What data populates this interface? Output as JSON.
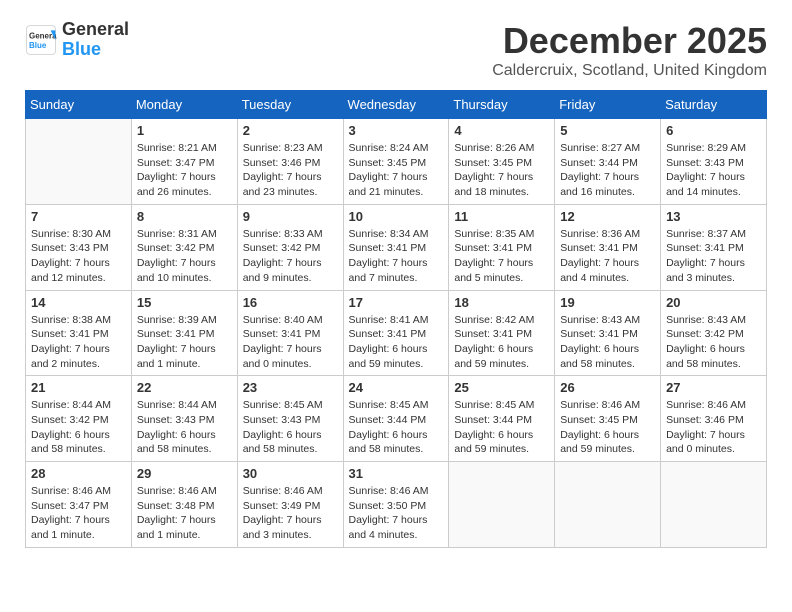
{
  "logo": {
    "general": "General",
    "blue": "Blue"
  },
  "title": "December 2025",
  "location": "Caldercruix, Scotland, United Kingdom",
  "weekdays": [
    "Sunday",
    "Monday",
    "Tuesday",
    "Wednesday",
    "Thursday",
    "Friday",
    "Saturday"
  ],
  "weeks": [
    [
      {
        "day": "",
        "info": ""
      },
      {
        "day": "1",
        "info": "Sunrise: 8:21 AM\nSunset: 3:47 PM\nDaylight: 7 hours\nand 26 minutes."
      },
      {
        "day": "2",
        "info": "Sunrise: 8:23 AM\nSunset: 3:46 PM\nDaylight: 7 hours\nand 23 minutes."
      },
      {
        "day": "3",
        "info": "Sunrise: 8:24 AM\nSunset: 3:45 PM\nDaylight: 7 hours\nand 21 minutes."
      },
      {
        "day": "4",
        "info": "Sunrise: 8:26 AM\nSunset: 3:45 PM\nDaylight: 7 hours\nand 18 minutes."
      },
      {
        "day": "5",
        "info": "Sunrise: 8:27 AM\nSunset: 3:44 PM\nDaylight: 7 hours\nand 16 minutes."
      },
      {
        "day": "6",
        "info": "Sunrise: 8:29 AM\nSunset: 3:43 PM\nDaylight: 7 hours\nand 14 minutes."
      }
    ],
    [
      {
        "day": "7",
        "info": "Sunrise: 8:30 AM\nSunset: 3:43 PM\nDaylight: 7 hours\nand 12 minutes."
      },
      {
        "day": "8",
        "info": "Sunrise: 8:31 AM\nSunset: 3:42 PM\nDaylight: 7 hours\nand 10 minutes."
      },
      {
        "day": "9",
        "info": "Sunrise: 8:33 AM\nSunset: 3:42 PM\nDaylight: 7 hours\nand 9 minutes."
      },
      {
        "day": "10",
        "info": "Sunrise: 8:34 AM\nSunset: 3:41 PM\nDaylight: 7 hours\nand 7 minutes."
      },
      {
        "day": "11",
        "info": "Sunrise: 8:35 AM\nSunset: 3:41 PM\nDaylight: 7 hours\nand 5 minutes."
      },
      {
        "day": "12",
        "info": "Sunrise: 8:36 AM\nSunset: 3:41 PM\nDaylight: 7 hours\nand 4 minutes."
      },
      {
        "day": "13",
        "info": "Sunrise: 8:37 AM\nSunset: 3:41 PM\nDaylight: 7 hours\nand 3 minutes."
      }
    ],
    [
      {
        "day": "14",
        "info": "Sunrise: 8:38 AM\nSunset: 3:41 PM\nDaylight: 7 hours\nand 2 minutes."
      },
      {
        "day": "15",
        "info": "Sunrise: 8:39 AM\nSunset: 3:41 PM\nDaylight: 7 hours\nand 1 minute."
      },
      {
        "day": "16",
        "info": "Sunrise: 8:40 AM\nSunset: 3:41 PM\nDaylight: 7 hours\nand 0 minutes."
      },
      {
        "day": "17",
        "info": "Sunrise: 8:41 AM\nSunset: 3:41 PM\nDaylight: 6 hours\nand 59 minutes."
      },
      {
        "day": "18",
        "info": "Sunrise: 8:42 AM\nSunset: 3:41 PM\nDaylight: 6 hours\nand 59 minutes."
      },
      {
        "day": "19",
        "info": "Sunrise: 8:43 AM\nSunset: 3:41 PM\nDaylight: 6 hours\nand 58 minutes."
      },
      {
        "day": "20",
        "info": "Sunrise: 8:43 AM\nSunset: 3:42 PM\nDaylight: 6 hours\nand 58 minutes."
      }
    ],
    [
      {
        "day": "21",
        "info": "Sunrise: 8:44 AM\nSunset: 3:42 PM\nDaylight: 6 hours\nand 58 minutes."
      },
      {
        "day": "22",
        "info": "Sunrise: 8:44 AM\nSunset: 3:43 PM\nDaylight: 6 hours\nand 58 minutes."
      },
      {
        "day": "23",
        "info": "Sunrise: 8:45 AM\nSunset: 3:43 PM\nDaylight: 6 hours\nand 58 minutes."
      },
      {
        "day": "24",
        "info": "Sunrise: 8:45 AM\nSunset: 3:44 PM\nDaylight: 6 hours\nand 58 minutes."
      },
      {
        "day": "25",
        "info": "Sunrise: 8:45 AM\nSunset: 3:44 PM\nDaylight: 6 hours\nand 59 minutes."
      },
      {
        "day": "26",
        "info": "Sunrise: 8:46 AM\nSunset: 3:45 PM\nDaylight: 6 hours\nand 59 minutes."
      },
      {
        "day": "27",
        "info": "Sunrise: 8:46 AM\nSunset: 3:46 PM\nDaylight: 7 hours\nand 0 minutes."
      }
    ],
    [
      {
        "day": "28",
        "info": "Sunrise: 8:46 AM\nSunset: 3:47 PM\nDaylight: 7 hours\nand 1 minute."
      },
      {
        "day": "29",
        "info": "Sunrise: 8:46 AM\nSunset: 3:48 PM\nDaylight: 7 hours\nand 1 minute."
      },
      {
        "day": "30",
        "info": "Sunrise: 8:46 AM\nSunset: 3:49 PM\nDaylight: 7 hours\nand 3 minutes."
      },
      {
        "day": "31",
        "info": "Sunrise: 8:46 AM\nSunset: 3:50 PM\nDaylight: 7 hours\nand 4 minutes."
      },
      {
        "day": "",
        "info": ""
      },
      {
        "day": "",
        "info": ""
      },
      {
        "day": "",
        "info": ""
      }
    ]
  ]
}
